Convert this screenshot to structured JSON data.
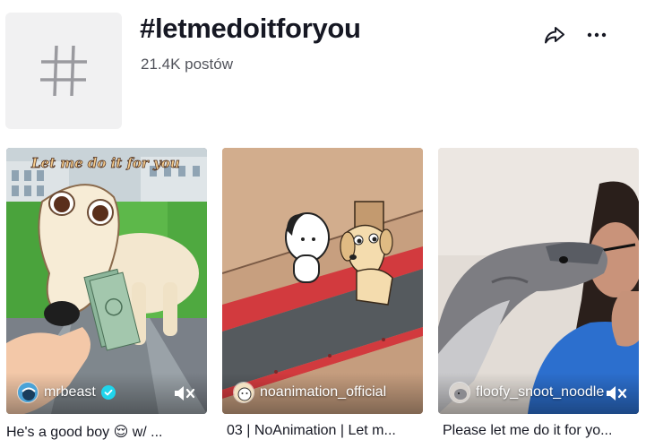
{
  "hashtag": {
    "title": "#letmedoitforyou",
    "post_count": "21.4K postów"
  },
  "icons": {
    "hashtag": "hashtag-icon",
    "share": "share-icon",
    "more": "more-dots-icon",
    "mute": "muted-speaker-icon",
    "verified": "verified-badge-icon"
  },
  "videos": [
    {
      "author": "mrbeast",
      "verified": true,
      "caption": "He's a good boy 😌 w/ ...",
      "overlay_text": "Let me do it for you"
    },
    {
      "author": "noanimation_official",
      "verified": false,
      "caption": "03 | NoAnimation | Let m..."
    },
    {
      "author": "floofy_snoot_noodle",
      "verified": false,
      "caption": "Please let me do it for yo..."
    }
  ]
}
